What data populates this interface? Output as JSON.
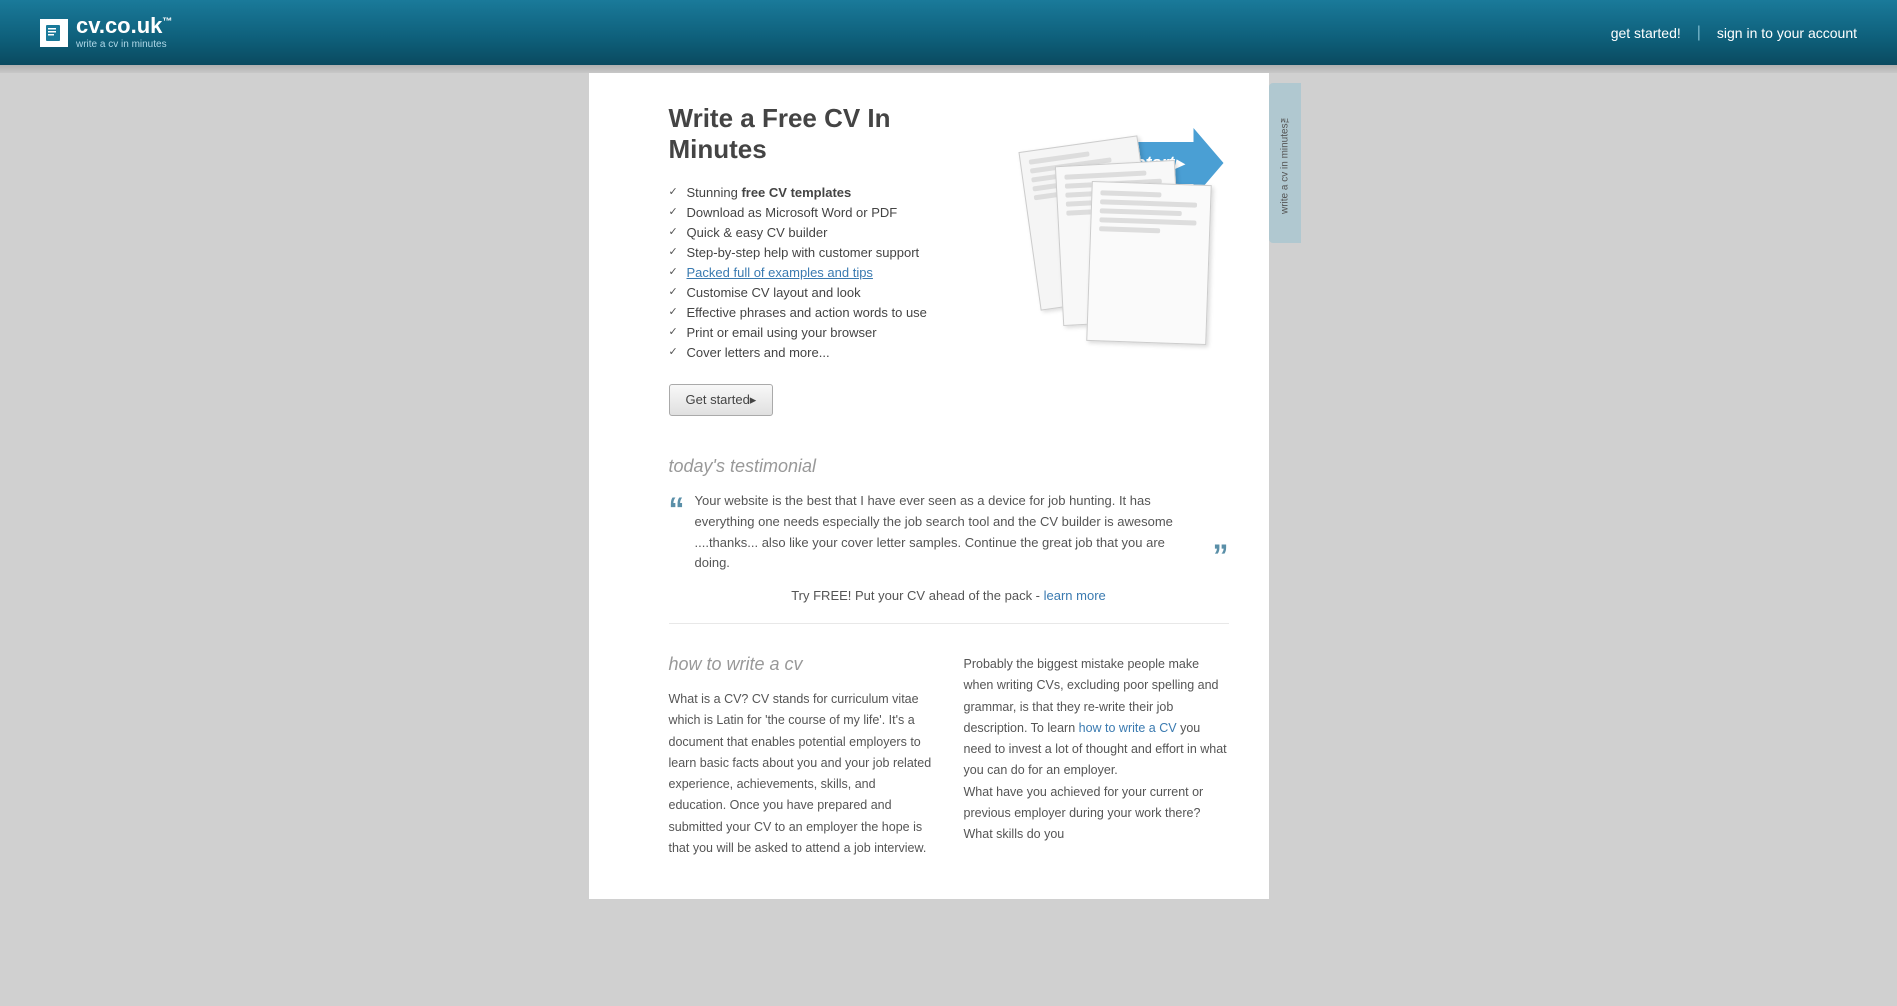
{
  "header": {
    "logo_text": "cv.co.uk",
    "logo_superscript": "™",
    "logo_tagline": "write a cv in minutes",
    "nav_get_started": "get started!",
    "nav_divider": "|",
    "nav_sign_in": "sign in to your account"
  },
  "side_tab": {
    "label": "write a cv in minutes™"
  },
  "hero": {
    "title": "Write a Free CV In Minutes",
    "features": [
      {
        "text": "Stunning ",
        "bold": "free CV templates"
      },
      {
        "text": "Download as Microsoft Word or PDF"
      },
      {
        "text": "Quick & easy CV builder"
      },
      {
        "text": "Step-by-step help with customer support"
      },
      {
        "text": "Packed full of examples and tips"
      },
      {
        "text": "Customise CV layout and look"
      },
      {
        "text": "Effective phrases and action words to use"
      },
      {
        "text": "Print or email using your browser"
      },
      {
        "text": "Cover letters and more..."
      }
    ],
    "get_started_btn": "Get started▸",
    "start_arrow_label": "start▸"
  },
  "testimonial": {
    "section_title": "today's testimonial",
    "quote": "Your website is the best that I have ever seen as a device for job hunting. It has everything one needs especially the job search tool and the CV builder is awesome ....thanks... also like your cover letter samples. Continue the great job that you are doing.",
    "try_free_prefix": "Try FREE! Put your CV ahead of the pack - ",
    "learn_more_link": "learn more"
  },
  "how_to": {
    "section_title": "how to write a cv",
    "col1_text": "What is a CV? CV stands for curriculum vitae which is Latin for 'the course of my life'. It's a document that enables potential employers to learn basic facts about you and your job related experience, achievements, skills, and education. Once you have prepared and submitted your CV to an employer the hope is that you will be asked to attend a job interview.",
    "col2_para1": "Probably the biggest mistake people make when writing CVs, excluding poor spelling and grammar, is that they re-write their job description. To learn ",
    "col2_link": "how to write a CV",
    "col2_para1_end": " you need to invest a lot of thought and effort in what you can do for an employer.",
    "col2_para2": "What have you achieved for your current or previous employer during your work there? What skills do you"
  }
}
